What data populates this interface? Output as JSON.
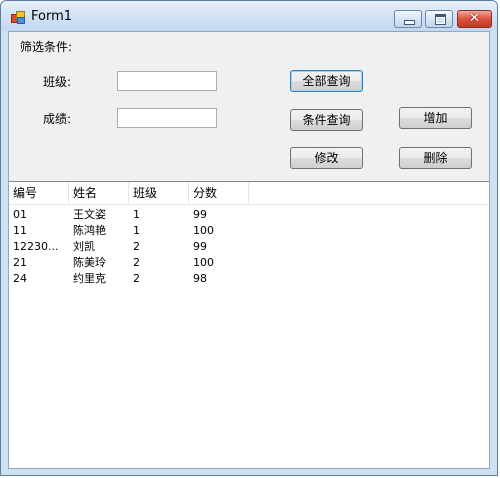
{
  "window": {
    "title": "Form1"
  },
  "filter": {
    "heading": "筛选条件:",
    "class_label": "班级:",
    "class_value": "",
    "score_label": "成绩:",
    "score_value": ""
  },
  "buttons": {
    "query_all": "全部查询",
    "query_condition": "条件查询",
    "add": "增加",
    "edit": "修改",
    "delete": "删除"
  },
  "table": {
    "columns": [
      "编号",
      "姓名",
      "班级",
      "分数"
    ],
    "rows": [
      [
        "01",
        "王文姿",
        "1",
        "99"
      ],
      [
        "11",
        "陈鸿艳",
        "1",
        "100"
      ],
      [
        "12230...",
        "刘凯",
        "2",
        "99"
      ],
      [
        "21",
        "陈美玲",
        "2",
        "100"
      ],
      [
        "24",
        "约里克",
        "2",
        "98"
      ]
    ]
  },
  "icons": {
    "app": "form-app-icon",
    "minimize": "minimize-icon",
    "maximize": "maximize-icon",
    "close": "close-icon"
  },
  "colors": {
    "title_bar": "#cfe0f3",
    "close_button": "#c23a23",
    "client_bg": "#f0f0f0"
  }
}
